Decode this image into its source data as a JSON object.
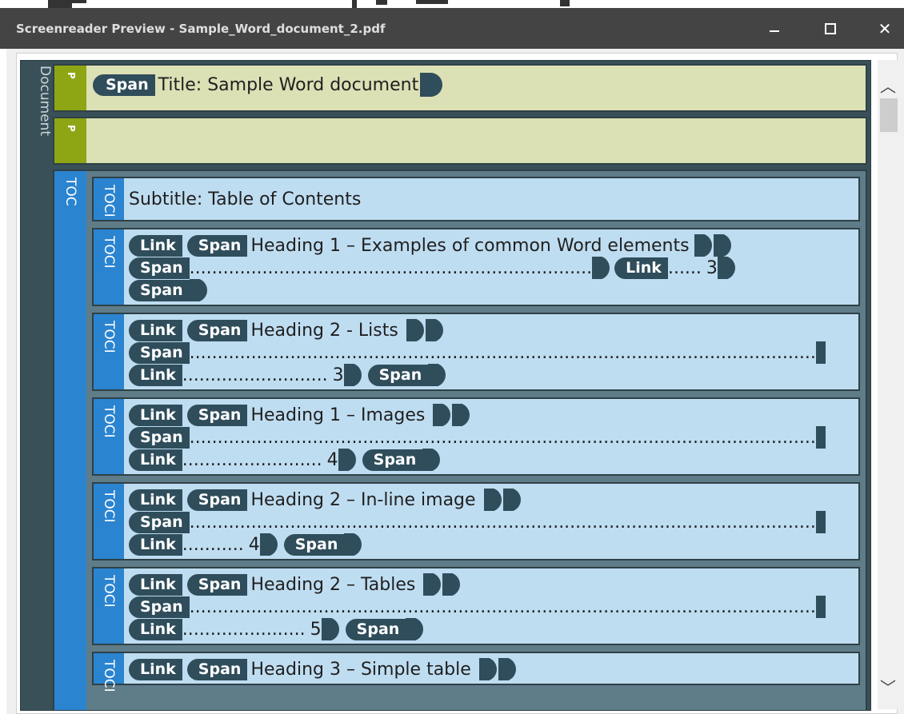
{
  "window": {
    "title": "Screenreader Preview - Sample_Word_document_2.pdf",
    "minimize_label": "–",
    "maximize_label": "□",
    "close_label": "✕"
  },
  "tree": {
    "document_label": "Document",
    "p_label": "P",
    "toc_label": "TOC",
    "toci_label": "TOCI",
    "link_label": "Link",
    "span_label": "Span",
    "title_text": "Title: Sample Word document",
    "subtitle_text": "Subtitle: Table of Contents",
    "entries": [
      {
        "heading": "Heading 1 – Examples of common Word elements",
        "dots1": "........................................................................",
        "dots2": "......",
        "page": "3"
      },
      {
        "heading": "Heading 2 - Lists",
        "dots1": "................................................................................................................",
        "dots2": "..........................",
        "page": "3"
      },
      {
        "heading": "Heading 1 – Images",
        "dots1": "................................................................................................................",
        "dots2": ".........................",
        "page": "4"
      },
      {
        "heading": "Heading 2 – In-line image",
        "dots1": "................................................................................................................",
        "dots2": "...........",
        "page": "4"
      },
      {
        "heading": "Heading 2 – Tables",
        "dots1": "................................................................................................................",
        "dots2": "......................",
        "page": "5"
      },
      {
        "heading": "Heading 3 – Simple table"
      }
    ]
  }
}
